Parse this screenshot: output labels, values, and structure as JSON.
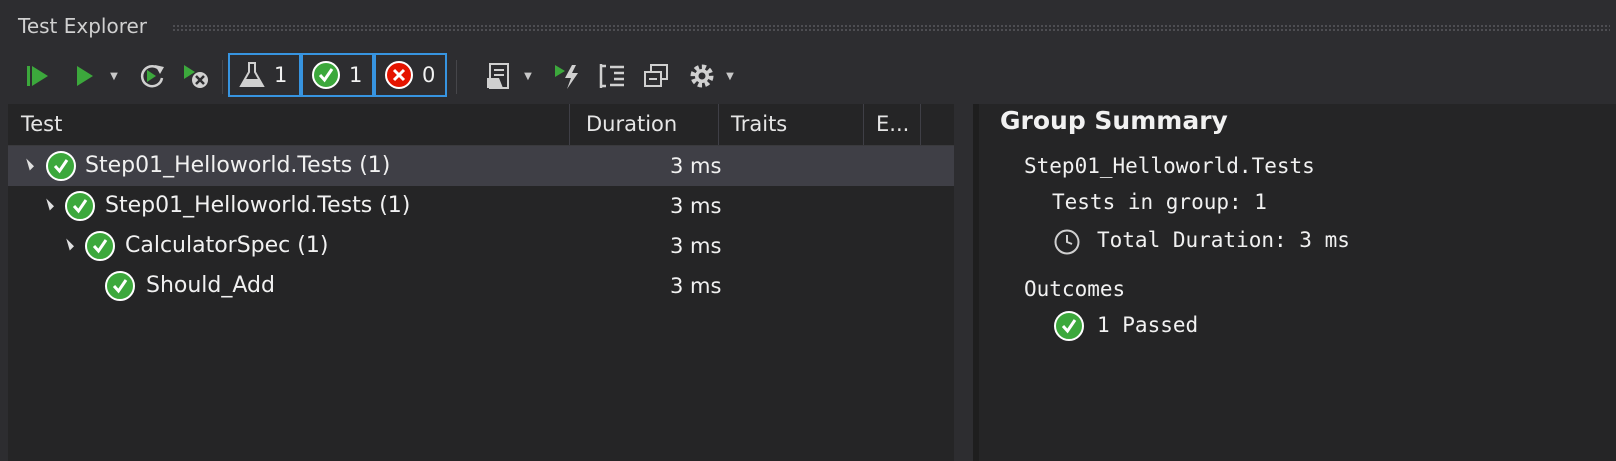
{
  "window": {
    "title": "Test Explorer"
  },
  "toolbar": {
    "counters": [
      {
        "icon": "flask-icon",
        "value": "1"
      },
      {
        "icon": "passed-icon",
        "value": "1"
      },
      {
        "icon": "failed-icon",
        "value": "0"
      }
    ]
  },
  "table": {
    "headers": {
      "test": "Test",
      "duration": "Duration",
      "traits": "Traits",
      "error": "E..."
    },
    "rows": [
      {
        "name": "Step01_Helloworld.Tests",
        "count": "(1)",
        "duration": "3 ms",
        "selected": true
      },
      {
        "name": "Step01_Helloworld.Tests",
        "count": "(1)",
        "duration": "3 ms",
        "selected": false
      },
      {
        "name": "CalculatorSpec",
        "count": "(1)",
        "duration": "3 ms",
        "selected": false
      },
      {
        "name": "Should_Add",
        "count": "",
        "duration": "3 ms",
        "selected": false
      }
    ]
  },
  "summary": {
    "title": "Group Summary",
    "group_name": "Step01_Helloworld.Tests",
    "tests_in_group": "Tests in group: 1",
    "total_duration": "Total Duration: 3 ms",
    "outcomes_label": "Outcomes",
    "passed": "1 Passed"
  },
  "colors": {
    "accent": "#3794e0",
    "passed": "#3ca83c",
    "failed": "#e51400",
    "run": "#3ca83c"
  }
}
